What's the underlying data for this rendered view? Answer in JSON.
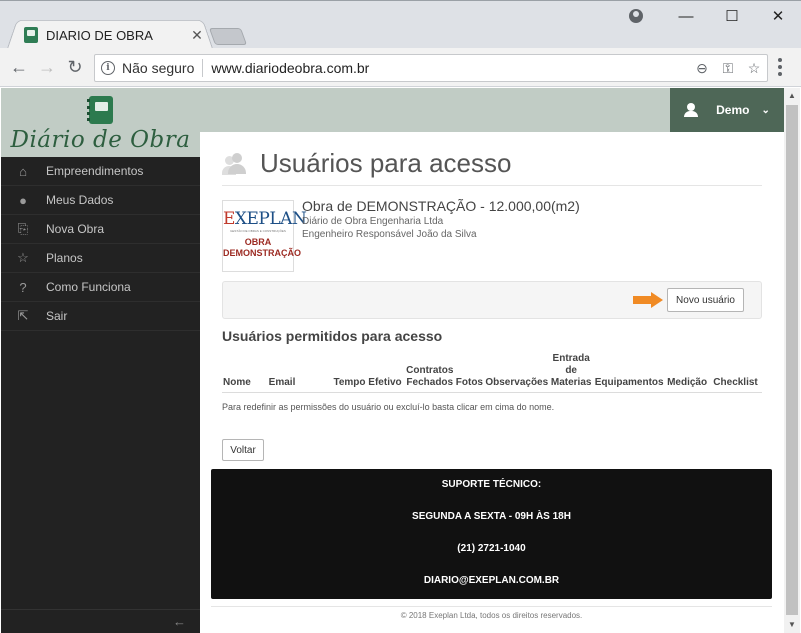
{
  "browser": {
    "tab_title": "DIARIO DE OBRA",
    "tab_close": "✕",
    "security_label": "Não seguro",
    "url": "www.diariodeobra.com.br",
    "window_controls": {
      "minimize": "—",
      "maximize": "☐",
      "close": "✕"
    },
    "nav": {
      "back": "←",
      "forward": "→",
      "reload": "↻"
    },
    "icons": [
      "zoom-icon",
      "key-icon",
      "star-icon",
      "menu-icon"
    ]
  },
  "brand": {
    "name": "Diário de Obra"
  },
  "user_menu": {
    "name": "Demo",
    "caret": "⌄"
  },
  "sidebar": {
    "items": [
      {
        "label": "Empreendimentos",
        "icon": "home-icon",
        "glyph": "⌂"
      },
      {
        "label": "Meus Dados",
        "icon": "user-icon",
        "glyph": "●"
      },
      {
        "label": "Nova Obra",
        "icon": "new-document-icon",
        "glyph": "⎘"
      },
      {
        "label": "Planos",
        "icon": "star-icon",
        "glyph": "☆"
      },
      {
        "label": "Como Funciona",
        "icon": "question-icon",
        "glyph": "?"
      },
      {
        "label": "Sair",
        "icon": "exit-icon",
        "glyph": "⇱"
      }
    ],
    "collapse": "←"
  },
  "page": {
    "title": "Usuários para acesso",
    "project": {
      "logo_word_a": "E",
      "logo_word_b": "XEPLAN",
      "logo_sub": "GESTÃO DE OBRAS E CONSTRUÇÕES",
      "logo_line1": "OBRA",
      "logo_line2": "DEMONSTRAÇÃO",
      "name": "Obra de DEMONSTRAÇÃO - 12.000,00(m2)",
      "company": "Diário de Obra Engenharia Ltda",
      "engineer": "Engenheiro Responsável João da Silva"
    },
    "new_user_button": "Novo usuário",
    "section_title": "Usuários permitidos para acesso",
    "table_headers": [
      "Nome",
      "Email",
      "Tempo Efetivo",
      "Contratos Fechados",
      "Fotos",
      "Observações",
      "Entrada de Materias",
      "Equipamentos",
      "Medição",
      "Checklist"
    ],
    "hint": "Para redefinir as permissões do usuário ou excluí-lo basta clicar em cima do nome.",
    "back_button": "Voltar"
  },
  "support": {
    "line1": "SUPORTE TÉCNICO:",
    "line2": "SEGUNDA A SEXTA - 09H ÀS 18H",
    "line3": "(21) 2721-1040",
    "line4": "DIARIO@EXEPLAN.COM.BR"
  },
  "footer": {
    "copyright": "© 2018 Exeplan Ltda, todos os direitos reservados."
  },
  "colors": {
    "brand_bg": "#c1ccc5",
    "user_menu_bg": "#4e6757",
    "sidebar_bg": "#222222",
    "accent_arrow": "#f08a24",
    "support_bg": "#111111"
  }
}
